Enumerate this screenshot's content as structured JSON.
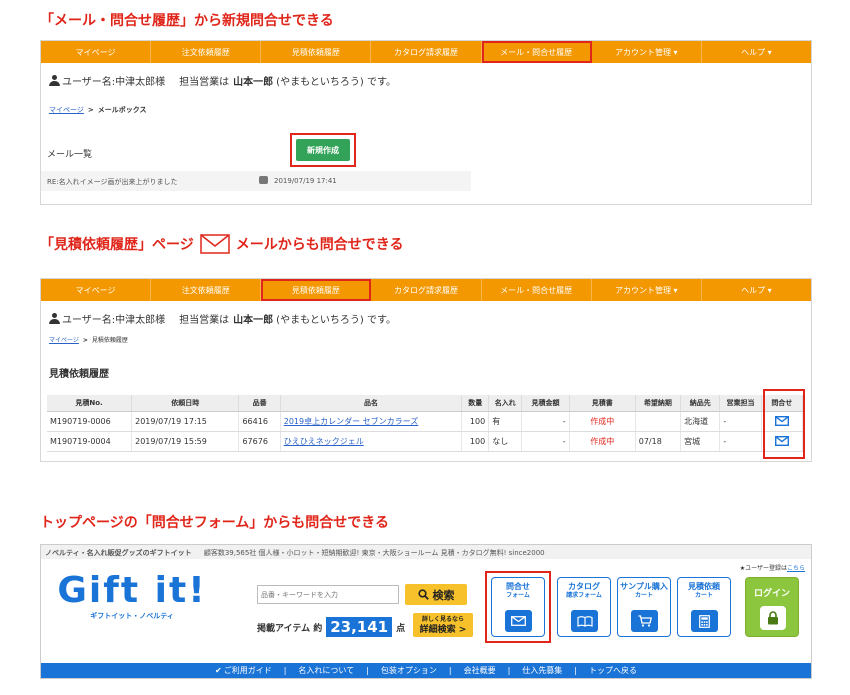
{
  "headings": {
    "h1": "「メール・問合せ履歴」から新規問合せできる",
    "h2_part1": "「見積依頼履歴」ページ",
    "h2_part2": "メールからも問合せできる",
    "h3": "トップページの「問合せフォーム」からも問合せできる"
  },
  "nav": [
    "マイページ",
    "注文依頼履歴",
    "見積依頼履歴",
    "カタログ請求履歴",
    "メール・問合せ履歴",
    "アカウント管理 ▾",
    "ヘルプ ▾"
  ],
  "user": {
    "label": "ユーザー名:中津太郎様",
    "rep_prefix": "担当営業は",
    "rep_name": "山本一郎",
    "rep_suffix": "(やまもといちろう) です。"
  },
  "panel1": {
    "crumb_link": "マイページ",
    "crumb_current": "メールボックス",
    "list_title": "メール一覧",
    "new_button": "新規作成",
    "mail_subject": "RE:名入れイメージ画が出来上がりました",
    "mail_date": "2019/07/19 17:41"
  },
  "panel2": {
    "crumb_link": "マイページ",
    "crumb_current": "見積依頼履歴",
    "title": "見積依頼履歴",
    "columns": [
      "見積No.",
      "依頼日時",
      "品番",
      "品名",
      "数量",
      "名入れ",
      "見積金額",
      "見積書",
      "希望納期",
      "納品先",
      "営業担当",
      "問合せ"
    ],
    "rows": [
      {
        "no": "M190719-0006",
        "date": "2019/07/19 17:15",
        "code": "66416",
        "name": "2019卓上カレンダー セブンカラーズ",
        "qty": "100",
        "print": "有",
        "amount": "-",
        "doc": "作成中",
        "deadline": "",
        "dest": "北海道",
        "rep": "-"
      },
      {
        "no": "M190719-0004",
        "date": "2019/07/19 15:59",
        "code": "67676",
        "name": "ひえひえネックジェル",
        "qty": "100",
        "print": "なし",
        "amount": "-",
        "doc": "作成中",
        "deadline": "07/18",
        "dest": "宮城",
        "rep": "-"
      }
    ]
  },
  "panel3": {
    "tagline": "ノベルティ・名入れ販促グッズのギフトイット",
    "stats": "顧客数39,565社 個人様・小ロット・短納期歓迎! 東京・大阪ショールーム 見積・カタログ無料! since2000",
    "register_text": "★ユーザー登録は",
    "register_link": "こちら",
    "logo_main": "Gift it!",
    "logo_sub": "ギフトイット・ノベルティ",
    "search_placeholder": "品番・キーワードを入力",
    "search_button": "検索",
    "items_prefix": "掲載アイテム 約",
    "items_count": "23,141",
    "items_suffix": "点",
    "detail_small": "詳しく見るなら",
    "detail_button": "詳細検索 >",
    "buttons": [
      {
        "title": "問合せ",
        "sub": "フォーム"
      },
      {
        "title": "カタログ",
        "sub": "請求フォーム"
      },
      {
        "title": "サンプル購入",
        "sub": "カート"
      },
      {
        "title": "見積依頼",
        "sub": "カート"
      }
    ],
    "login": "ログイン",
    "bottom_nav": [
      "ご利用ガイド",
      "名入れについて",
      "包装オプション",
      "会社概要",
      "仕入先募集",
      "トップへ戻る"
    ]
  },
  "colors": {
    "accent_red": "#e0261a",
    "nav_orange": "#f39800",
    "green": "#33a35a",
    "brand_blue": "#1a73d6"
  }
}
